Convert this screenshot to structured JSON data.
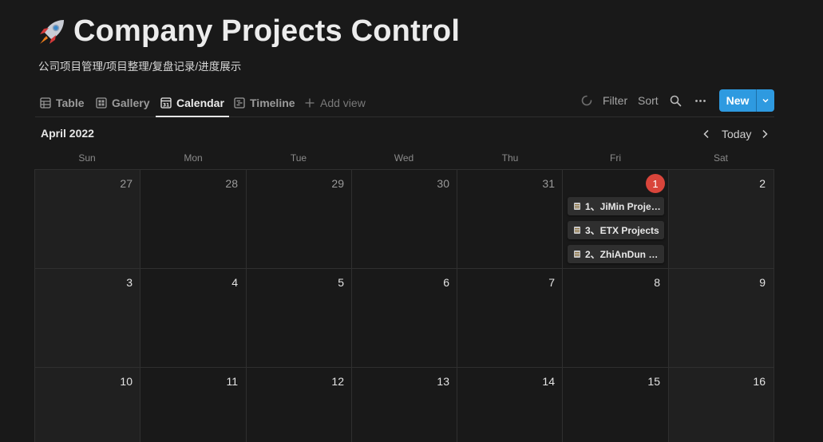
{
  "page": {
    "title": "Company Projects Control",
    "subtitle": "公司项目管理/项目整理/复盘记录/进度展示"
  },
  "views": {
    "tabs": [
      {
        "label": "Table",
        "icon": "table-icon"
      },
      {
        "label": "Gallery",
        "icon": "gallery-icon"
      },
      {
        "label": "Calendar",
        "icon": "calendar-icon",
        "active": true
      },
      {
        "label": "Timeline",
        "icon": "timeline-icon"
      }
    ],
    "add_view_label": "Add view"
  },
  "toolbar": {
    "filter_label": "Filter",
    "sort_label": "Sort",
    "new_label": "New",
    "accent_color": "#2e9ae0"
  },
  "calendar": {
    "month_label": "April 2022",
    "today_label": "Today",
    "weekdays": [
      "Sun",
      "Mon",
      "Tue",
      "Wed",
      "Thu",
      "Fri",
      "Sat"
    ],
    "weeks": [
      [
        "27",
        "28",
        "29",
        "30",
        "31",
        "1",
        "2"
      ],
      [
        "3",
        "4",
        "5",
        "6",
        "7",
        "8",
        "9"
      ],
      [
        "10",
        "11",
        "12",
        "13",
        "14",
        "15",
        "16"
      ]
    ],
    "today_badge_color": "#d9453b",
    "events": [
      {
        "text": "1、JiMin Proje…"
      },
      {
        "text": "3、ETX Projects"
      },
      {
        "text": "2、ZhiAnDun …"
      }
    ]
  }
}
